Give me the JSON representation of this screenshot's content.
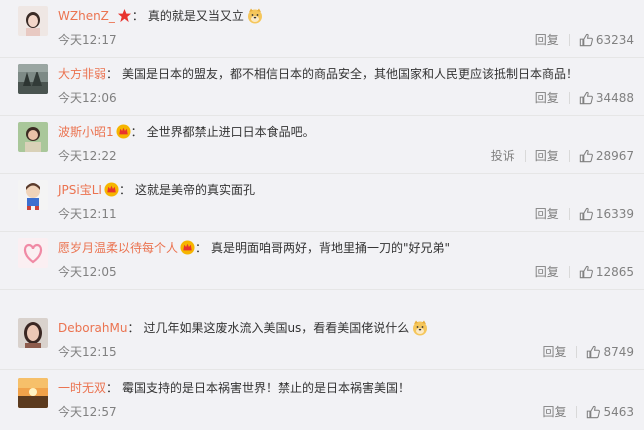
{
  "comments": [
    {
      "username": "WZhenZ_",
      "badge": "red-star",
      "text": "真的就是又当又立",
      "emoji": "doge",
      "time": "今天12:17",
      "show_report": false,
      "reply_label": "回复",
      "report_label": "",
      "likes": "63234"
    },
    {
      "username": "大方非弱",
      "badge": "",
      "text": "美国是日本的盟友，都不相信日本的商品安全，其他国家和人民更应该抵制日本商品！",
      "emoji": "",
      "time": "今天12:06",
      "show_report": false,
      "reply_label": "回复",
      "report_label": "",
      "likes": "34488"
    },
    {
      "username": "波斯小昭1",
      "badge": "crown",
      "text": "全世界都禁止进口日本食品吧。",
      "emoji": "",
      "time": "今天12:22",
      "show_report": true,
      "reply_label": "回复",
      "report_label": "投诉",
      "likes": "28967"
    },
    {
      "username": "JPSi宝LI",
      "badge": "crown",
      "text": "这就是美帝的真实面孔",
      "emoji": "",
      "time": "今天12:11",
      "show_report": false,
      "reply_label": "回复",
      "report_label": "",
      "likes": "16339"
    },
    {
      "username": "愿岁月温柔以待每个人",
      "badge": "crown",
      "text": "真是明面咱哥两好，背地里捅一刀的\"好兄弟\"",
      "emoji": "",
      "time": "今天12:05",
      "show_report": false,
      "reply_label": "回复",
      "report_label": "",
      "likes": "12865"
    },
    {
      "username": "DeborahMu",
      "badge": "",
      "text": "过几年如果这废水流入美国us，看看美国佬说什么",
      "emoji": "doge",
      "time": "今天12:15",
      "show_report": false,
      "reply_label": "回复",
      "report_label": "",
      "likes": "8749"
    },
    {
      "username": "一时无双",
      "badge": "",
      "text": "霉国支持的是日本祸害世界！禁止的是日本祸害美国！",
      "emoji": "",
      "time": "今天12:57",
      "show_report": false,
      "reply_label": "回复",
      "report_label": "",
      "likes": "5463"
    }
  ],
  "colors": {
    "username": "#eb7350",
    "text": "#333333",
    "meta": "#808080",
    "background": "#f2f2f5"
  }
}
